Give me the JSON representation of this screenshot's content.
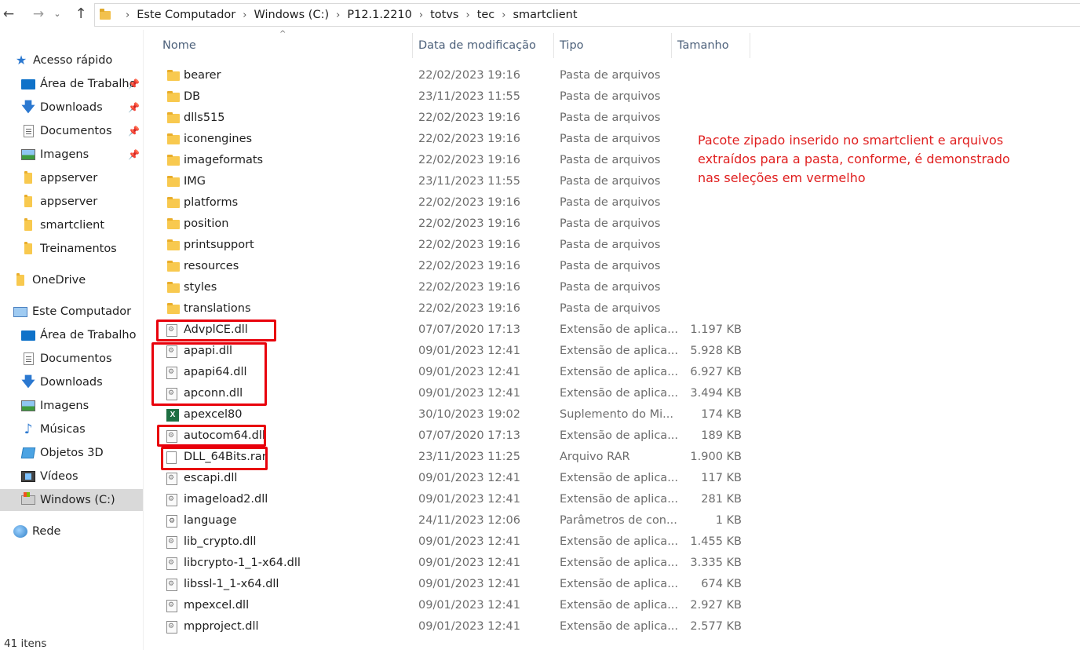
{
  "address_bar": {
    "back": "←",
    "forward": "→",
    "dropdown": "⌄",
    "up": "↑",
    "breadcrumb": [
      "Este Computador",
      "Windows (C:)",
      "P12.1.2210",
      "totvs",
      "tec",
      "smartclient"
    ],
    "separator": "›"
  },
  "nav_pane": {
    "quick_access": "Acesso rápido",
    "quick_items": [
      {
        "label": "Área de Trabalho",
        "icon": "desktop-icon",
        "pinned": true
      },
      {
        "label": "Downloads",
        "icon": "download-icon",
        "pinned": true
      },
      {
        "label": "Documentos",
        "icon": "document-icon",
        "pinned": true
      },
      {
        "label": "Imagens",
        "icon": "pictures-icon",
        "pinned": true
      },
      {
        "label": "appserver",
        "icon": "folder-icon",
        "pinned": false
      },
      {
        "label": "appserver",
        "icon": "folder-icon",
        "pinned": false
      },
      {
        "label": "smartclient",
        "icon": "folder-icon",
        "pinned": false
      },
      {
        "label": "Treinamentos",
        "icon": "folder-icon",
        "pinned": false
      }
    ],
    "onedrive": "OneDrive",
    "this_pc": "Este Computador",
    "pc_items": [
      {
        "label": "Área de Trabalho",
        "icon": "desktop-icon"
      },
      {
        "label": "Documentos",
        "icon": "document-icon"
      },
      {
        "label": "Downloads",
        "icon": "download-icon"
      },
      {
        "label": "Imagens",
        "icon": "pictures-icon"
      },
      {
        "label": "Músicas",
        "icon": "music-icon"
      },
      {
        "label": "Objetos 3D",
        "icon": "3d-objects-icon"
      },
      {
        "label": "Vídeos",
        "icon": "videos-icon"
      },
      {
        "label": "Windows (C:)",
        "icon": "drive-icon",
        "selected": true
      }
    ],
    "network": "Rede",
    "pin_glyph": "📌"
  },
  "columns": {
    "name": "Nome",
    "date": "Data de modificação",
    "type": "Tipo",
    "size": "Tamanho",
    "sort_glyph": "^"
  },
  "files": [
    {
      "name": "bearer",
      "date": "22/02/2023 19:16",
      "type": "Pasta de arquivos",
      "size": "",
      "icon": "folder-icon"
    },
    {
      "name": "DB",
      "date": "23/11/2023 11:55",
      "type": "Pasta de arquivos",
      "size": "",
      "icon": "folder-icon"
    },
    {
      "name": "dlls515",
      "date": "22/02/2023 19:16",
      "type": "Pasta de arquivos",
      "size": "",
      "icon": "folder-icon"
    },
    {
      "name": "iconengines",
      "date": "22/02/2023 19:16",
      "type": "Pasta de arquivos",
      "size": "",
      "icon": "folder-icon"
    },
    {
      "name": "imageformats",
      "date": "22/02/2023 19:16",
      "type": "Pasta de arquivos",
      "size": "",
      "icon": "folder-icon"
    },
    {
      "name": "IMG",
      "date": "23/11/2023 11:55",
      "type": "Pasta de arquivos",
      "size": "",
      "icon": "folder-icon"
    },
    {
      "name": "platforms",
      "date": "22/02/2023 19:16",
      "type": "Pasta de arquivos",
      "size": "",
      "icon": "folder-icon"
    },
    {
      "name": "position",
      "date": "22/02/2023 19:16",
      "type": "Pasta de arquivos",
      "size": "",
      "icon": "folder-icon"
    },
    {
      "name": "printsupport",
      "date": "22/02/2023 19:16",
      "type": "Pasta de arquivos",
      "size": "",
      "icon": "folder-icon"
    },
    {
      "name": "resources",
      "date": "22/02/2023 19:16",
      "type": "Pasta de arquivos",
      "size": "",
      "icon": "folder-icon"
    },
    {
      "name": "styles",
      "date": "22/02/2023 19:16",
      "type": "Pasta de arquivos",
      "size": "",
      "icon": "folder-icon"
    },
    {
      "name": "translations",
      "date": "22/02/2023 19:16",
      "type": "Pasta de arquivos",
      "size": "",
      "icon": "folder-icon"
    },
    {
      "name": "AdvplCE.dll",
      "date": "07/07/2020 17:13",
      "type": "Extensão de aplica...",
      "size": "1.197 KB",
      "icon": "dll-icon"
    },
    {
      "name": "apapi.dll",
      "date": "09/01/2023 12:41",
      "type": "Extensão de aplica...",
      "size": "5.928 KB",
      "icon": "dll-icon"
    },
    {
      "name": "apapi64.dll",
      "date": "09/01/2023 12:41",
      "type": "Extensão de aplica...",
      "size": "6.927 KB",
      "icon": "dll-icon"
    },
    {
      "name": "apconn.dll",
      "date": "09/01/2023 12:41",
      "type": "Extensão de aplica...",
      "size": "3.494 KB",
      "icon": "dll-icon"
    },
    {
      "name": "apexcel80",
      "date": "30/10/2023 19:02",
      "type": "Suplemento do Mi...",
      "size": "174 KB",
      "icon": "excel-icon"
    },
    {
      "name": "autocom64.dll",
      "date": "07/07/2020 17:13",
      "type": "Extensão de aplica...",
      "size": "189 KB",
      "icon": "dll-icon"
    },
    {
      "name": "DLL_64Bits.rar",
      "date": "23/11/2023 11:25",
      "type": "Arquivo RAR",
      "size": "1.900 KB",
      "icon": "rar-icon"
    },
    {
      "name": "escapi.dll",
      "date": "09/01/2023 12:41",
      "type": "Extensão de aplica...",
      "size": "117 KB",
      "icon": "dll-icon"
    },
    {
      "name": "imageload2.dll",
      "date": "09/01/2023 12:41",
      "type": "Extensão de aplica...",
      "size": "281 KB",
      "icon": "dll-icon"
    },
    {
      "name": "language",
      "date": "24/11/2023 12:06",
      "type": "Parâmetros de con...",
      "size": "1 KB",
      "icon": "config-file-icon"
    },
    {
      "name": "lib_crypto.dll",
      "date": "09/01/2023 12:41",
      "type": "Extensão de aplica...",
      "size": "1.455 KB",
      "icon": "dll-icon"
    },
    {
      "name": "libcrypto-1_1-x64.dll",
      "date": "09/01/2023 12:41",
      "type": "Extensão de aplica...",
      "size": "3.335 KB",
      "icon": "dll-icon"
    },
    {
      "name": "libssl-1_1-x64.dll",
      "date": "09/01/2023 12:41",
      "type": "Extensão de aplica...",
      "size": "674 KB",
      "icon": "dll-icon"
    },
    {
      "name": "mpexcel.dll",
      "date": "09/01/2023 12:41",
      "type": "Extensão de aplica...",
      "size": "2.927 KB",
      "icon": "dll-icon"
    },
    {
      "name": "mpproject.dll",
      "date": "09/01/2023 12:41",
      "type": "Extensão de aplica...",
      "size": "2.577 KB",
      "icon": "dll-icon"
    }
  ],
  "annotation": {
    "lines": [
      "Pacote zipado inserido no smartclient e arquivos",
      "extraídos para a pasta, conforme, é demonstrado",
      "nas seleções em vermelho"
    ],
    "color": "#e8000b"
  },
  "status_bar": {
    "item_count": "41 itens"
  }
}
